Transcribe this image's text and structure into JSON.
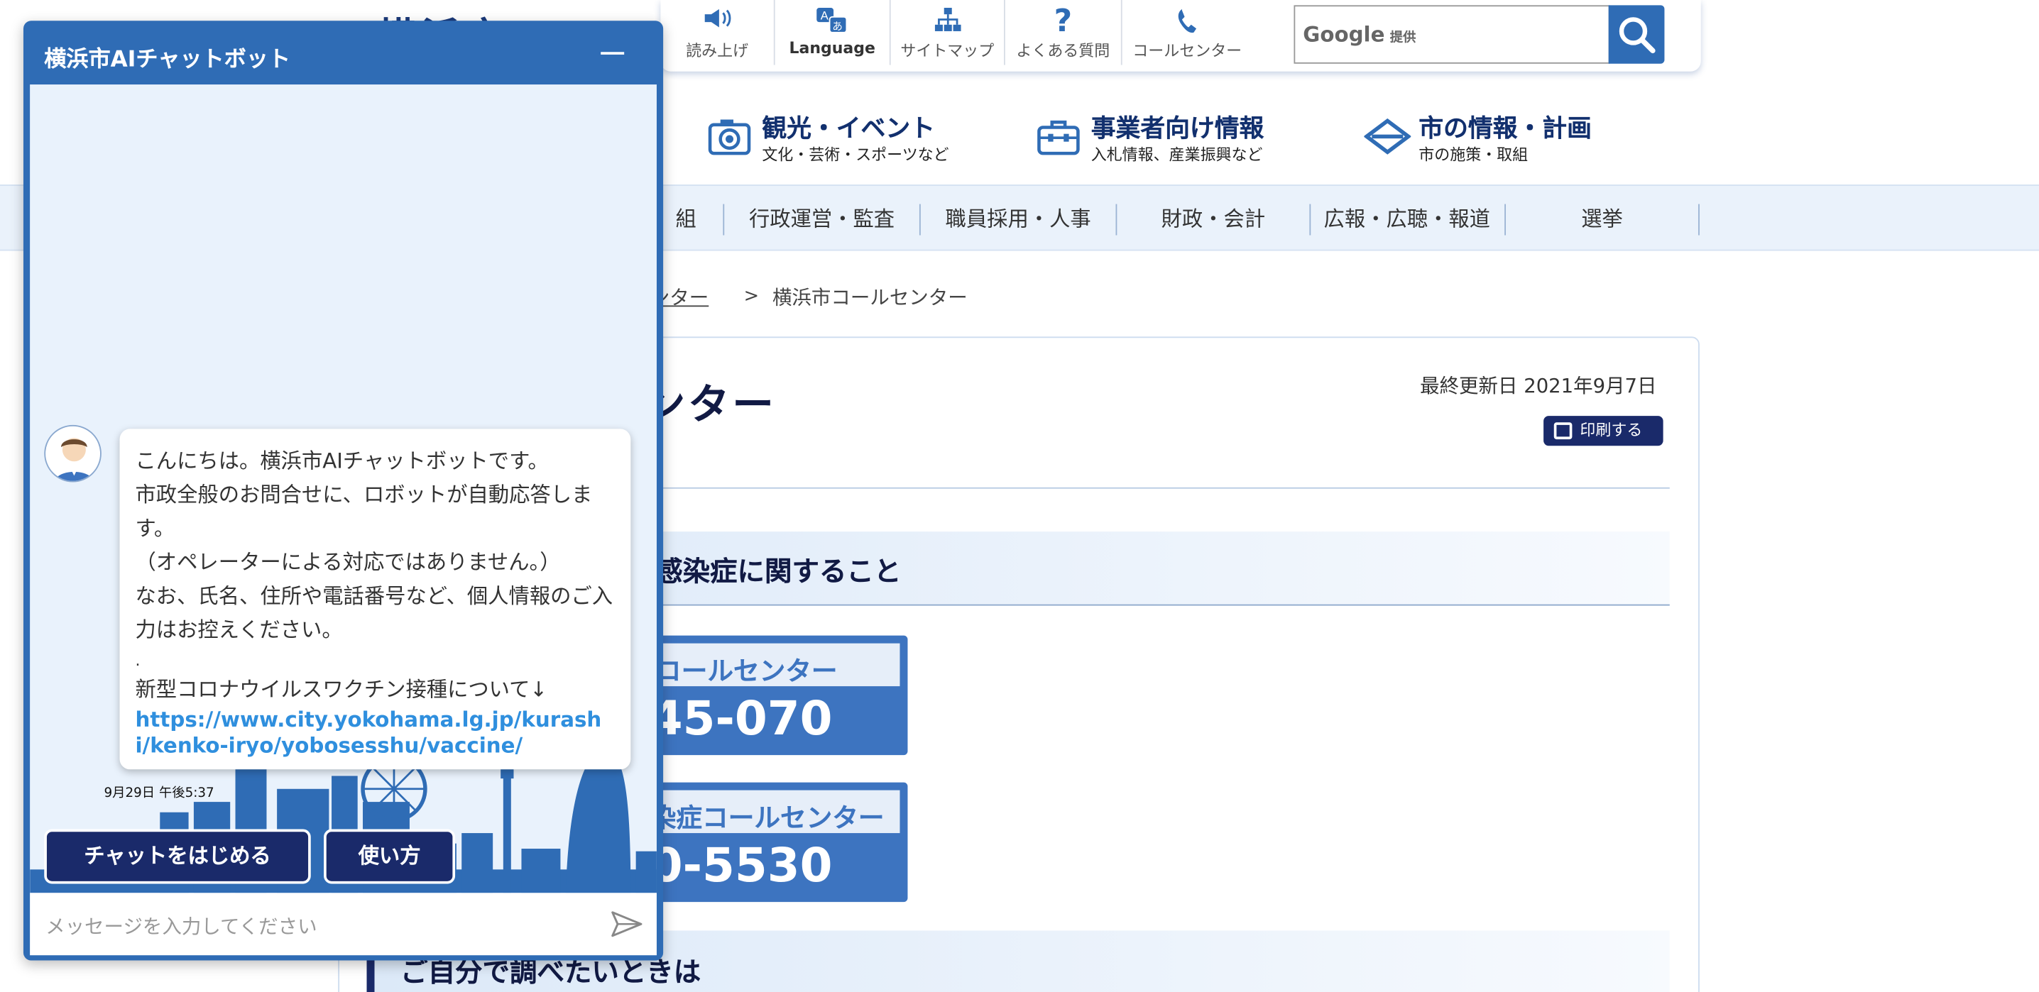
{
  "site": {
    "logo_text": "横浜市",
    "toolbar": [
      {
        "label": "読み上げ",
        "icon": "speaker-icon"
      },
      {
        "label": "Language",
        "icon": "language-icon"
      },
      {
        "label": "サイトマップ",
        "icon": "sitemap-icon"
      },
      {
        "label": "よくある質問",
        "icon": "question-icon"
      },
      {
        "label": "コールセンター",
        "icon": "phone-icon"
      }
    ],
    "search": {
      "brand": "Google",
      "brand_suffix": "提供"
    },
    "categories": [
      {
        "title": "観光・イベント",
        "sub": "文化・芸術・スポーツなど",
        "icon": "camera-icon"
      },
      {
        "title": "事業者向け情報",
        "sub": "入札情報、産業振興など",
        "icon": "toolbox-icon"
      },
      {
        "title": "市の情報・計画",
        "sub": "市の施策・取組",
        "icon": "city-emblem-icon"
      }
    ],
    "nav": [
      "組",
      "行政運営・監査",
      "職員採用・人事",
      "財政・会計",
      "広報・広聴・報道",
      "選挙"
    ],
    "breadcrumb": {
      "link": "ンター",
      "separator": ">",
      "current": "横浜市コールセンター"
    },
    "page_title": "ンター",
    "updated": "最終更新日 2021年9月7日",
    "print_label": "印刷する",
    "section1": "感染症に関すること",
    "call_cards": [
      {
        "title": "コールセンター",
        "number": "45-070"
      },
      {
        "title": "染症コールセンター",
        "number": "0-5530"
      }
    ],
    "section2": "ご自分で調べたいときは"
  },
  "chat": {
    "title": "横浜市AIチャットボット",
    "message_lines": [
      "こんにちは。横浜市AIチャットボットです。",
      "市政全般のお問合せに、ロボットが自動応答します。",
      "（オペレーターによる対応ではありません。）",
      "なお、氏名、住所や電話番号など、個人情報のご入力はお控えください。"
    ],
    "message_dot": ".",
    "vaccine_line": "新型コロナウイルスワクチン接種について↓",
    "link": "https://www.city.yokohama.lg.jp/kurashi/kenko-iryo/yobosesshu/vaccine/",
    "timestamp": "9月29日 午後5:37",
    "start_button": "チャットをはじめる",
    "howto_button": "使い方",
    "input_placeholder": "メッセージを入力してください"
  },
  "colors": {
    "brand_blue": "#2f6cb5",
    "navy": "#1a2a6a",
    "link": "#2f8fde",
    "nav_band": "#eaf2fb"
  }
}
